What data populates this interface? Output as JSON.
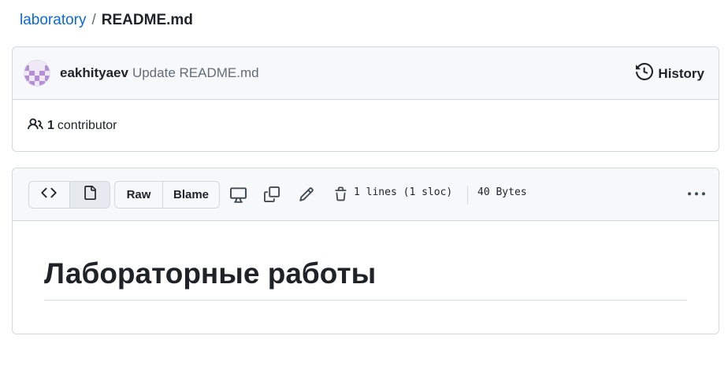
{
  "breadcrumb": {
    "repo": "laboratory",
    "separator": "/",
    "file": "README.md"
  },
  "commit": {
    "author": "eakhityaev",
    "message": "Update README.md",
    "history_label": "History",
    "contributors_count": "1",
    "contributors_label": "contributor"
  },
  "file_toolbar": {
    "raw_label": "Raw",
    "blame_label": "Blame",
    "lines_info": "1 lines (1 sloc)",
    "size_info": "40 Bytes"
  },
  "readme": {
    "heading": "Лабораторные работы"
  },
  "colors": {
    "link": "#0969da",
    "border": "#d0d7de",
    "header_bg": "#f6f8fa",
    "text": "#1f2328",
    "muted": "#636c76"
  },
  "icons": [
    "history-icon",
    "people-icon",
    "code-icon",
    "file-icon",
    "desktop-icon",
    "copy-icon",
    "pencil-icon",
    "trash-icon",
    "kebab-icon"
  ]
}
